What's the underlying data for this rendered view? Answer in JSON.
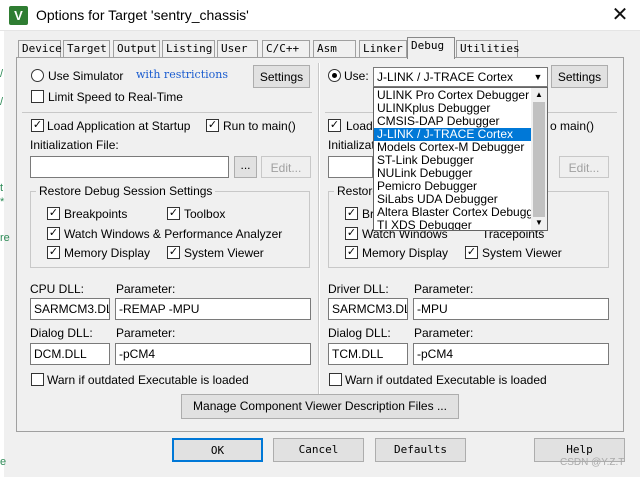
{
  "window": {
    "title": "Options for Target 'sentry_chassis'",
    "app_icon_glyph": "V",
    "close_glyph": "✕"
  },
  "background": {
    "glyphs": [
      "/",
      "/",
      "t",
      "*",
      "re",
      "e"
    ]
  },
  "tabs": [
    "Device",
    "Target",
    "Output",
    "Listing",
    "User",
    "C/C++",
    "Asm",
    "Linker",
    "Debug",
    "Utilities"
  ],
  "active_tab": "Debug",
  "left": {
    "use_simulator": "Use Simulator",
    "with_restrictions": "with restrictions",
    "settings": "Settings",
    "limit_speed": "Limit Speed to Real-Time",
    "load_app": "Load Application at Startup",
    "run_to_main": "Run to main()",
    "init_file_label": "Initialization File:",
    "init_file_value": "",
    "browse": "...",
    "edit": "Edit...",
    "restore_title": "Restore Debug Session Settings",
    "breakpoints": "Breakpoints",
    "toolbox": "Toolbox",
    "watch_windows": "Watch Windows & Performance Analyzer",
    "memory_display": "Memory Display",
    "system_viewer": "System Viewer",
    "cpu_dll_label": "CPU DLL:",
    "cpu_param_label": "Parameter:",
    "cpu_dll": "SARMCM3.DLL",
    "cpu_param": "-REMAP -MPU",
    "dialog_dll_label": "Dialog DLL:",
    "dialog_param_label": "Parameter:",
    "dialog_dll": "DCM.DLL",
    "dialog_param": "-pCM4",
    "warn": "Warn if outdated Executable is loaded"
  },
  "right": {
    "use": "Use:",
    "selected_debugger": "J-LINK / J-TRACE Cortex",
    "settings": "Settings",
    "load": "Load",
    "run_to_main_tail": "o main()",
    "init_label": "Initialization",
    "edit": "Edit...",
    "restore_prefix": "Restore",
    "breakpoints_prefix": "Bre",
    "watch_windows": "Watch Windows",
    "tracepoints": "Tracepoints",
    "memory_display": "Memory Display",
    "system_viewer": "System Viewer",
    "driver_dll_label": "Driver DLL:",
    "driver_param_label": "Parameter:",
    "driver_dll": "SARMCM3.DLL",
    "driver_param": "-MPU",
    "dialog_dll_label": "Dialog DLL:",
    "dialog_param_label": "Parameter:",
    "dialog_dll": "TCM.DLL",
    "dialog_param": "-pCM4",
    "warn": "Warn if outdated Executable is loaded"
  },
  "debugger_options": [
    "ULINK Pro Cortex Debugger",
    "ULINKplus Debugger",
    "CMSIS-DAP Debugger",
    "J-LINK / J-TRACE Cortex",
    "Models Cortex-M Debugger",
    "ST-Link Debugger",
    "NULink Debugger",
    "Pemicro Debugger",
    "SiLabs UDA Debugger",
    "Altera Blaster Cortex Debugger",
    "TI XDS Debugger"
  ],
  "selected_index": 3,
  "manage_button": "Manage Component Viewer Description Files ...",
  "footer": {
    "ok": "OK",
    "cancel": "Cancel",
    "defaults": "Defaults",
    "help": "Help",
    "watermark": "CSDN @Y.Z.T"
  },
  "colors": {
    "selection": "#0078d7",
    "link": "#1a5ccf",
    "dialog_bg": "#f0f0f0"
  }
}
